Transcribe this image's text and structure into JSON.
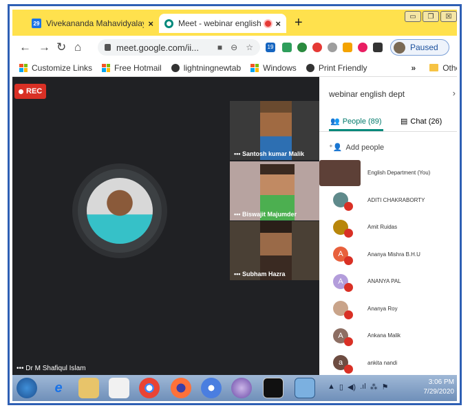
{
  "tabs": [
    {
      "icon": "calendar-icon",
      "badge": "29",
      "title": "Vivekananda Mahavidyalaya - Ca",
      "close": "×"
    },
    {
      "icon": "meet-icon",
      "title": "Meet - webinar english dept",
      "close": "×"
    }
  ],
  "new_tab": "+",
  "window_controls": [
    "▭",
    "❐",
    "☒"
  ],
  "address": {
    "url": "meet.google.com/ii...",
    "extension_badge": "19",
    "profile_status": "Paused"
  },
  "bookmarks": [
    {
      "label": "Customize Links",
      "icon": "microsoft-icon"
    },
    {
      "label": "Free Hotmail",
      "icon": "microsoft-icon"
    },
    {
      "label": "lightningnewtab",
      "icon": "globe-icon"
    },
    {
      "label": "Windows",
      "icon": "microsoft-icon"
    },
    {
      "label": "Print Friendly",
      "icon": "globe-icon"
    }
  ],
  "bookmarks_more": "»",
  "bookmarks_other": "Other bookmarl",
  "meet": {
    "rec_label": "REC",
    "main_name": "Dr M Shafiqul Islam",
    "tiles": [
      {
        "name": "Santosh kumar Malik"
      },
      {
        "name": "Biswajit Majumder"
      },
      {
        "name": "Subham Hazra"
      }
    ]
  },
  "panel": {
    "title": "webinar english dept",
    "close": "›",
    "people_tab": "People (89)",
    "chat_tab": "Chat (26)",
    "add_people": "Add people",
    "participants": [
      {
        "name": "English Department (You)",
        "initial": "",
        "color": "#5d4037",
        "muted": false
      },
      {
        "name": "ADITI CHAKRABORTY",
        "initial": "",
        "color": "#5f8a8b",
        "muted": true
      },
      {
        "name": "Amit Ruidas",
        "initial": "",
        "color": "#b8860b",
        "muted": true
      },
      {
        "name": "Ananya Mishra B.H.U",
        "initial": "A",
        "color": "#e8603c",
        "muted": true
      },
      {
        "name": "ANANYA PAL",
        "initial": "A",
        "color": "#b39ddb",
        "muted": true
      },
      {
        "name": "Ananya Roy",
        "initial": "",
        "color": "#c9a48a",
        "muted": true
      },
      {
        "name": "Ankana Malik",
        "initial": "A",
        "color": "#8d6e63",
        "muted": true
      },
      {
        "name": "ankita nandi",
        "initial": "a",
        "color": "#6d4c41",
        "muted": true
      }
    ]
  },
  "taskbar": {
    "time": "3:06 PM",
    "date": "7/29/2020"
  },
  "colors": {
    "tabbar": "#ffe14d",
    "meet_bg": "#202124",
    "accent_teal": "#00897b",
    "rec_red": "#d93025",
    "frame_blue": "#2e5fb4"
  }
}
